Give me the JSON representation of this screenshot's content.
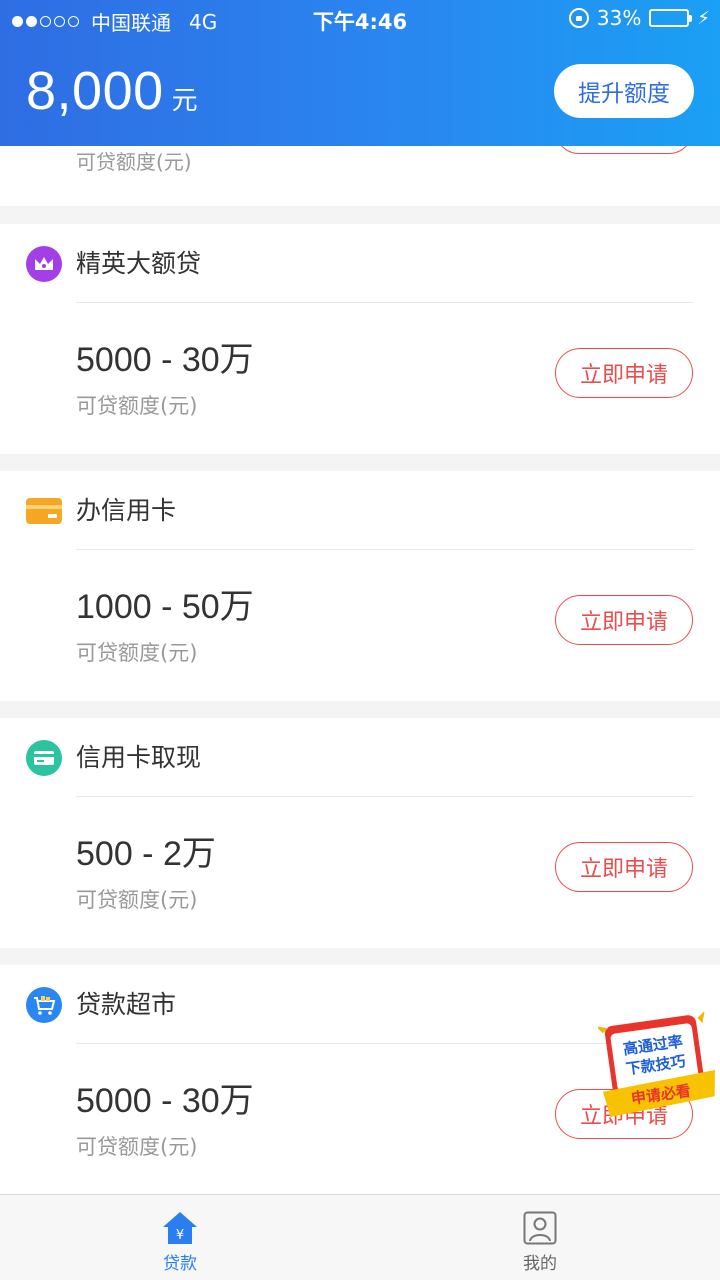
{
  "status_bar": {
    "carrier": "中国联通",
    "network": "4G",
    "time": "下午4:46",
    "battery": "33%",
    "battery_level": 0.33
  },
  "header": {
    "amount": "8,000",
    "unit": "元",
    "raise_button": "提升额度"
  },
  "partial_card": {
    "subtitle": "可贷额度(元)"
  },
  "cards": [
    {
      "title": "精英大额贷",
      "range": "5000 - 30万",
      "subtitle": "可贷额度(元)",
      "button": "立即申请",
      "icon": "crown-icon",
      "color": "#a43ee6"
    },
    {
      "title": "办信用卡",
      "range": "1000 - 50万",
      "subtitle": "可贷额度(元)",
      "button": "立即申请",
      "icon": "card-icon",
      "color": "#f5a623"
    },
    {
      "title": "信用卡取现",
      "range": "500 - 2万",
      "subtitle": "可贷额度(元)",
      "button": "立即申请",
      "icon": "cash-card-icon",
      "color": "#2bc4a0"
    },
    {
      "title": "贷款超市",
      "range": "5000 - 30万",
      "subtitle": "可贷额度(元)",
      "button": "立即申请",
      "icon": "cart-icon",
      "color": "#2a86f0"
    }
  ],
  "promo": {
    "line1": "高通过率",
    "line2": "下款技巧",
    "ribbon": "申请必看"
  },
  "tabs": [
    {
      "label": "贷款",
      "icon": "home-yen-icon"
    },
    {
      "label": "我的",
      "icon": "profile-icon"
    }
  ],
  "colors": {
    "accent": "#2a7ef0",
    "apply_red": "#ee4c4c"
  }
}
